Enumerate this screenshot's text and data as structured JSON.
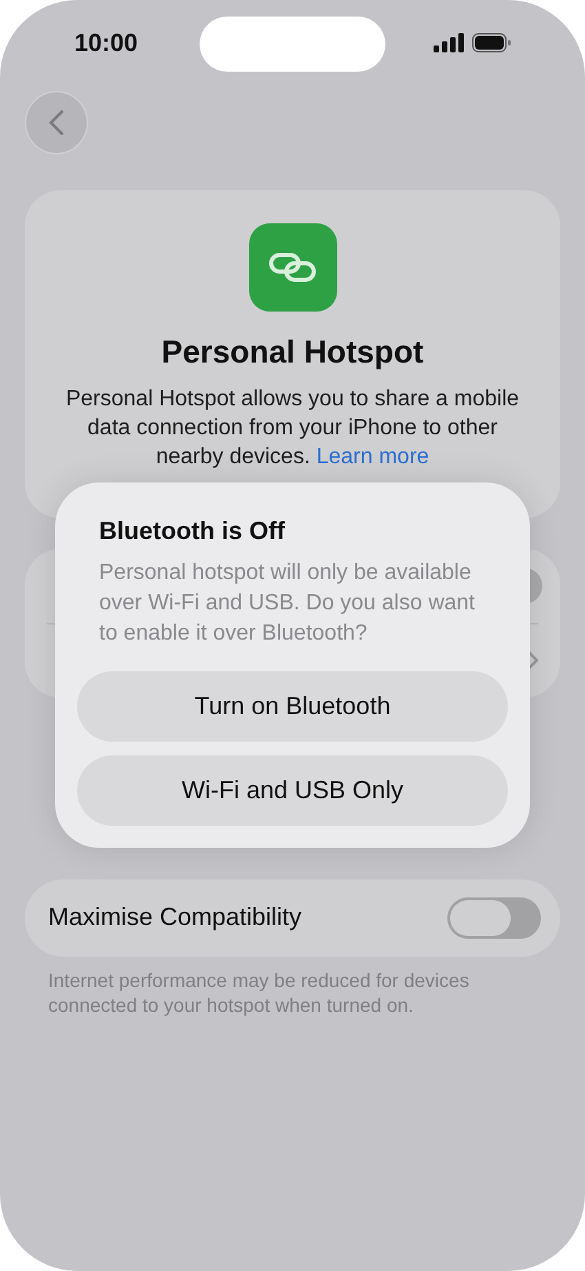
{
  "status_bar": {
    "time": "10:00"
  },
  "header": {
    "title": "Personal Hotspot",
    "description": "Personal Hotspot allows you to share a mobile data connection from your iPhone to other nearby devices.",
    "link": "Learn more"
  },
  "settings_rows": [
    {
      "kind": "toggle"
    },
    {
      "kind": "link"
    }
  ],
  "compatibility": {
    "label": "Maximise Compatibility",
    "on": false,
    "note": "Internet performance may be reduced for devices connected to your hotspot when turned on."
  },
  "dialog": {
    "title": "Bluetooth is Off",
    "message": "Personal hotspot will only be available over Wi-Fi and USB. Do you also want to enable it over Bluetooth?",
    "buttons": [
      "Turn on Bluetooth",
      "Wi-Fi and USB Only"
    ]
  }
}
